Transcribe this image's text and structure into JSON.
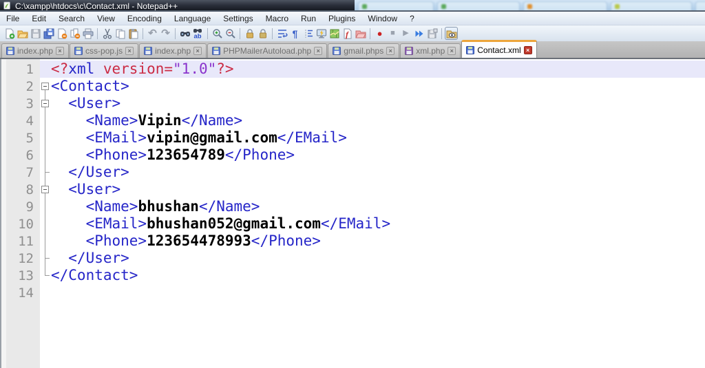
{
  "window": {
    "title": "C:\\xampp\\htdocs\\c\\Contact.xml - Notepad++"
  },
  "menu_bar": {
    "items": [
      "File",
      "Edit",
      "Search",
      "View",
      "Encoding",
      "Language",
      "Settings",
      "Macro",
      "Run",
      "Plugins",
      "Window",
      "?"
    ]
  },
  "toolbar": {
    "groups": [
      [
        "new-file",
        "open-folder",
        "save",
        "save-all",
        "close-file",
        "close-all-files",
        "print"
      ],
      [
        "cut",
        "copy",
        "paste"
      ],
      [
        "undo",
        "redo"
      ],
      [
        "find",
        "replace"
      ],
      [
        "zoom-in",
        "zoom-out"
      ],
      [
        "sync-vertical-scroll",
        "sync-horizontal-scroll"
      ],
      [
        "word-wrap",
        "show-all-characters",
        "show-indent-guide",
        "user-defined-language",
        "document-map",
        "function-list",
        "folder-as-workspace"
      ],
      [
        "macro-record",
        "macro-stop",
        "macro-play",
        "macro-run-multiple",
        "macro-save"
      ],
      [
        "monitoring"
      ]
    ],
    "pressed": [
      "monitoring"
    ]
  },
  "tab_bar": {
    "tabs": [
      {
        "label": "index.php",
        "icon": "floppy-blue",
        "active": false
      },
      {
        "label": "css-pop.js",
        "icon": "floppy-blue",
        "active": false
      },
      {
        "label": "index.php",
        "icon": "floppy-blue",
        "active": false
      },
      {
        "label": "PHPMailerAutoload.php",
        "icon": "floppy-blue",
        "active": false
      },
      {
        "label": "gmail.phps",
        "icon": "floppy-blue",
        "active": false
      },
      {
        "label": "xml.php",
        "icon": "floppy-purple",
        "active": false
      },
      {
        "label": "Contact.xml",
        "icon": "floppy-blue",
        "active": true
      }
    ]
  },
  "editor": {
    "language": "XML",
    "lines": [
      {
        "num": "1",
        "fold": "",
        "highlight": true,
        "tokens": [
          {
            "t": "red",
            "v": "<?"
          },
          {
            "t": "tag",
            "v": "xml"
          },
          {
            "t": "red",
            "v": " version="
          },
          {
            "t": "purple",
            "v": "\"1.0\""
          },
          {
            "t": "red",
            "v": "?>"
          }
        ]
      },
      {
        "num": "2",
        "fold": "box-start",
        "highlight": false,
        "tokens": [
          {
            "t": "tag",
            "v": "<Contact>"
          }
        ]
      },
      {
        "num": "3",
        "fold": "box-mid",
        "highlight": false,
        "tokens": [
          {
            "t": "tag",
            "v": "  <User>"
          }
        ]
      },
      {
        "num": "4",
        "fold": "line",
        "highlight": false,
        "tokens": [
          {
            "t": "tag",
            "v": "    <Name>"
          },
          {
            "t": "text",
            "v": "Vipin"
          },
          {
            "t": "tag",
            "v": "</Name>"
          }
        ]
      },
      {
        "num": "5",
        "fold": "line",
        "highlight": false,
        "tokens": [
          {
            "t": "tag",
            "v": "    <EMail>"
          },
          {
            "t": "text",
            "v": "vipin@gmail.com"
          },
          {
            "t": "tag",
            "v": "</EMail>"
          }
        ]
      },
      {
        "num": "6",
        "fold": "line",
        "highlight": false,
        "tokens": [
          {
            "t": "tag",
            "v": "    <Phone>"
          },
          {
            "t": "text",
            "v": "123654789"
          },
          {
            "t": "tag",
            "v": "</Phone>"
          }
        ]
      },
      {
        "num": "7",
        "fold": "tee",
        "highlight": false,
        "tokens": [
          {
            "t": "tag",
            "v": "  </User>"
          }
        ]
      },
      {
        "num": "8",
        "fold": "box-mid",
        "highlight": false,
        "tokens": [
          {
            "t": "tag",
            "v": "  <User>"
          }
        ]
      },
      {
        "num": "9",
        "fold": "line",
        "highlight": false,
        "tokens": [
          {
            "t": "tag",
            "v": "    <Name>"
          },
          {
            "t": "text",
            "v": "bhushan"
          },
          {
            "t": "tag",
            "v": "</Name>"
          }
        ]
      },
      {
        "num": "10",
        "fold": "line",
        "highlight": false,
        "tokens": [
          {
            "t": "tag",
            "v": "    <EMail>"
          },
          {
            "t": "text",
            "v": "bhushan052@gmail.com"
          },
          {
            "t": "tag",
            "v": "</EMail>"
          }
        ]
      },
      {
        "num": "11",
        "fold": "line",
        "highlight": false,
        "tokens": [
          {
            "t": "tag",
            "v": "    <Phone>"
          },
          {
            "t": "text",
            "v": "123654478993"
          },
          {
            "t": "tag",
            "v": "</Phone>"
          }
        ]
      },
      {
        "num": "12",
        "fold": "tee",
        "highlight": false,
        "tokens": [
          {
            "t": "tag",
            "v": "  </User>"
          }
        ]
      },
      {
        "num": "13",
        "fold": "corner",
        "highlight": false,
        "tokens": [
          {
            "t": "tag",
            "v": "</Contact>"
          }
        ]
      },
      {
        "num": "14",
        "fold": "",
        "highlight": false,
        "tokens": []
      }
    ]
  },
  "colors": {
    "tag_blue": "#2525c8",
    "content_black": "#000000",
    "declaration_red": "#cb2b44",
    "attr_value_purple": "#8a33cc",
    "line_highlight": "#e8e8fa",
    "active_tab_accent": "#eda53b",
    "title_bar_dark": "#12151d"
  }
}
